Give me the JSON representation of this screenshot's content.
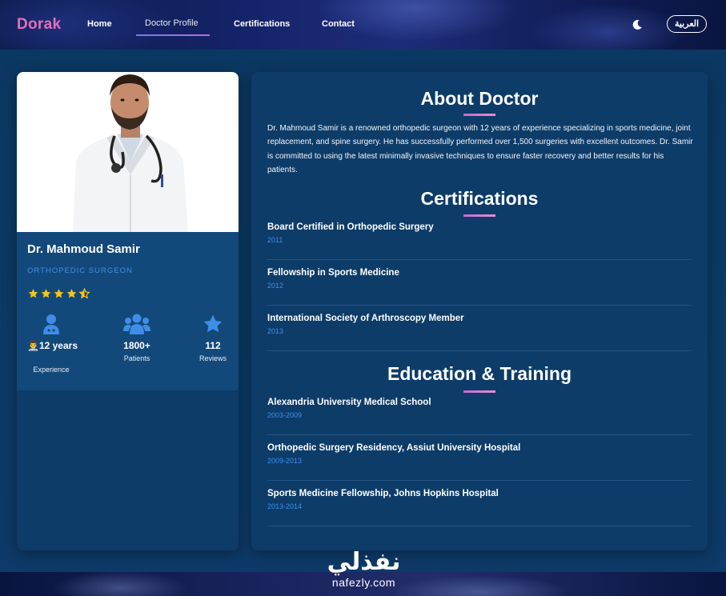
{
  "header": {
    "brand": "Dorak",
    "nav": [
      {
        "label": "Home"
      },
      {
        "label": "Doctor Profile"
      },
      {
        "label": "Certifications"
      },
      {
        "label": "Contact"
      }
    ],
    "theme_icon": "moon-icon",
    "language_button": "العربية"
  },
  "profile": {
    "name": "Dr. Mahmoud Samir",
    "specialty": "ORTHOPEDIC SURGEON",
    "rating": 4.5,
    "rating_max": 5,
    "stats": [
      {
        "icon": "doctor-icon",
        "value": "12 years",
        "label": "Experience"
      },
      {
        "icon": "users-icon",
        "value": "1800+",
        "label": "Patients"
      },
      {
        "icon": "star-icon",
        "value": "112",
        "label": "Reviews"
      }
    ]
  },
  "about": {
    "title": "About Doctor",
    "text": "Dr. Mahmoud Samir is a renowned orthopedic surgeon with 12 years of experience specializing in sports medicine, joint replacement, and spine surgery. He has successfully performed over 1,500 surgeries with excellent outcomes. Dr. Samir is committed to using the latest minimally invasive techniques to ensure faster recovery and better results for his patients."
  },
  "certifications": {
    "title": "Certifications",
    "items": [
      {
        "title": "Board Certified in Orthopedic Surgery",
        "year": "2011"
      },
      {
        "title": "Fellowship in Sports Medicine",
        "year": "2012"
      },
      {
        "title": "International Society of Arthroscopy Member",
        "year": "2013"
      }
    ]
  },
  "education": {
    "title": "Education & Training",
    "items": [
      {
        "title": "Alexandria University Medical School",
        "year": "2003-2009"
      },
      {
        "title": "Orthopedic Surgery Residency, Assiut University Hospital",
        "year": "2009-2013"
      },
      {
        "title": "Sports Medicine Fellowship, Johns Hopkins Hospital",
        "year": "2013-2014"
      }
    ]
  },
  "watermark": {
    "arabic": "نفذلي",
    "latin": "nafezly.com"
  },
  "colors": {
    "brand": "#e46fb8",
    "accent_blue": "#3e8ee8",
    "star": "#f5c518",
    "card": "#0d3c69"
  }
}
